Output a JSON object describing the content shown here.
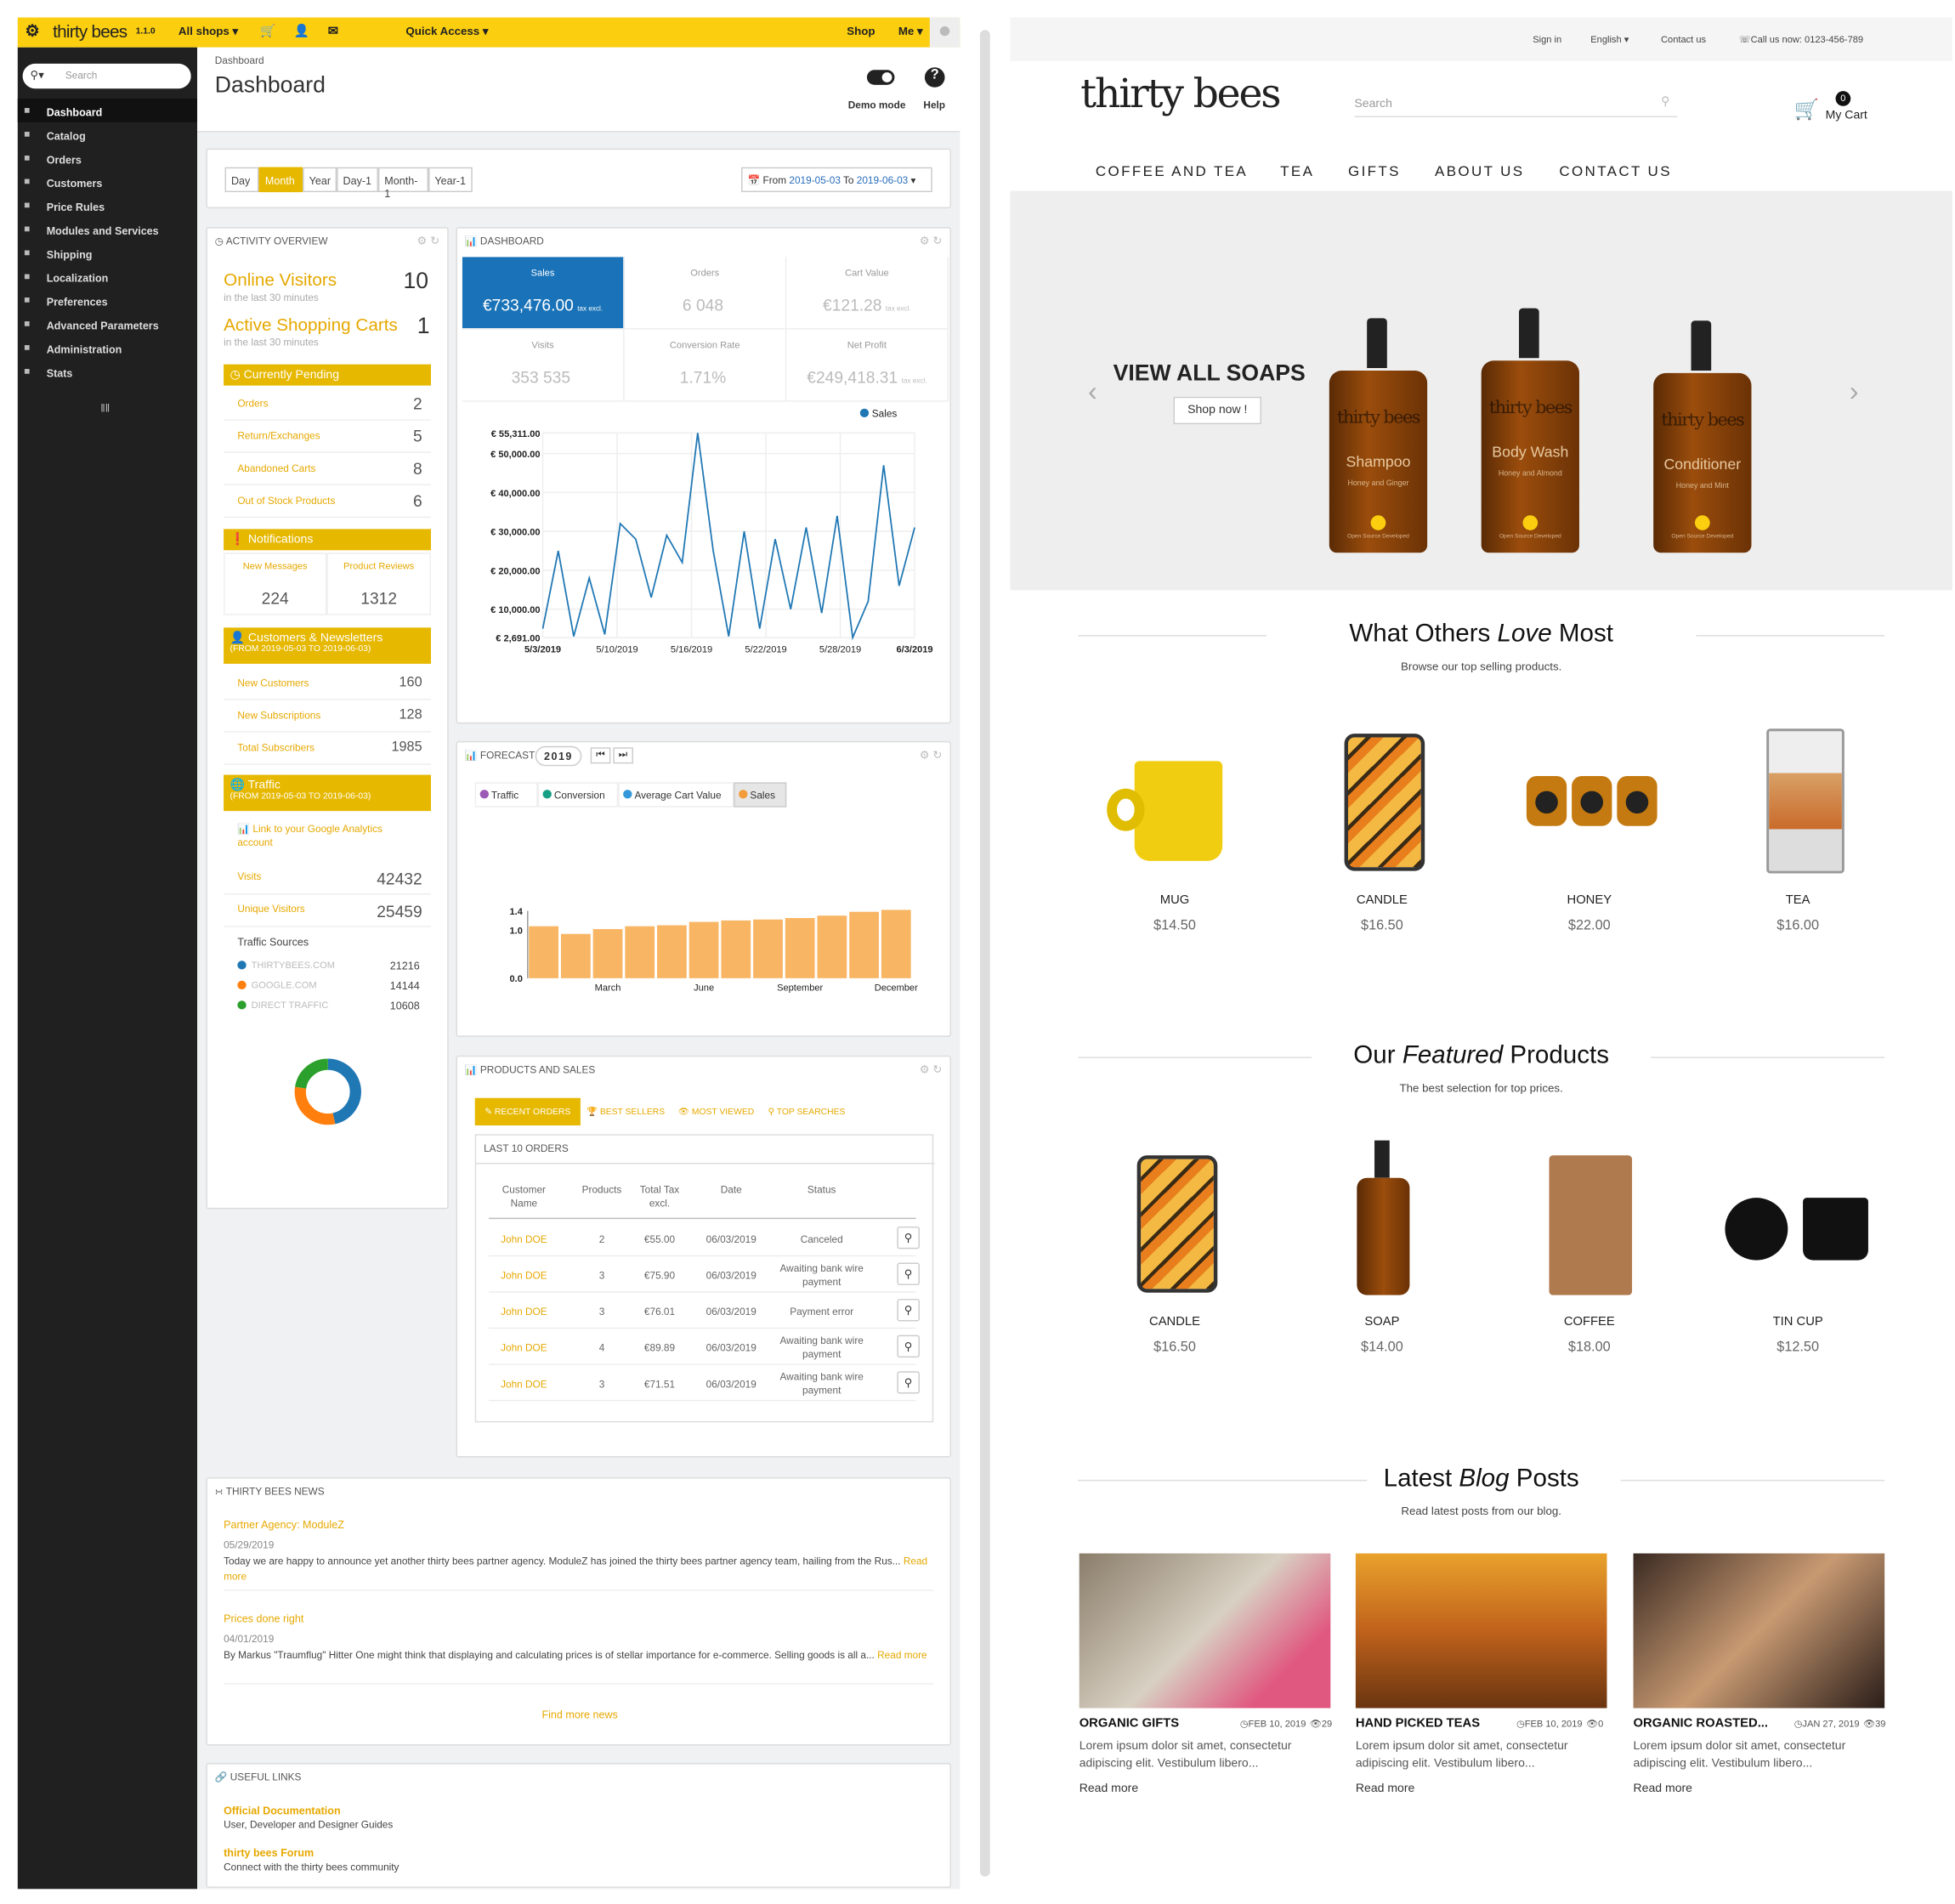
{
  "admin": {
    "logo": "thirty bees",
    "version": "1.1.0",
    "shops": "All shops",
    "quick_access": "Quick Access",
    "shop_link": "Shop",
    "me": "Me",
    "search_placeholder": "Search",
    "menu": [
      {
        "label": "Dashboard",
        "icon": "dashboard-icon"
      },
      {
        "label": "Catalog",
        "icon": "catalog-icon"
      },
      {
        "label": "Orders",
        "icon": "orders-icon"
      },
      {
        "label": "Customers",
        "icon": "customers-icon"
      },
      {
        "label": "Price Rules",
        "icon": "price-rules-icon"
      },
      {
        "label": "Modules and Services",
        "icon": "modules-icon"
      },
      {
        "label": "Shipping",
        "icon": "shipping-icon"
      },
      {
        "label": "Localization",
        "icon": "localization-icon"
      },
      {
        "label": "Preferences",
        "icon": "preferences-icon"
      },
      {
        "label": "Advanced Parameters",
        "icon": "advanced-icon"
      },
      {
        "label": "Administration",
        "icon": "administration-icon"
      },
      {
        "label": "Stats",
        "icon": "stats-icon"
      }
    ],
    "breadcrumb": "Dashboard",
    "page_title": "Dashboard",
    "demo_mode": "Demo mode",
    "help": "Help",
    "period_buttons": [
      "Day",
      "Month",
      "Year",
      "Day-1",
      "Month-1",
      "Year-1"
    ],
    "active_period": "Month",
    "date_from_label": "From",
    "date_from": "2019-05-03",
    "date_to_label": "To",
    "date_to": "2019-06-03",
    "activity": {
      "title": "Activity overview",
      "online_visitors": "Online Visitors",
      "online_visitors_value": "10",
      "sub1": "in the last 30 minutes",
      "active_carts": "Active Shopping Carts",
      "active_carts_value": "1",
      "sub2": "in the last 30 minutes",
      "pending_title": "Currently Pending",
      "pending": [
        {
          "label": "Orders",
          "value": "2"
        },
        {
          "label": "Return/Exchanges",
          "value": "5"
        },
        {
          "label": "Abandoned Carts",
          "value": "8"
        },
        {
          "label": "Out of Stock Products",
          "value": "6"
        }
      ],
      "notif_title": "Notifications",
      "new_messages": "New Messages",
      "new_messages_value": "224",
      "product_reviews": "Product Reviews",
      "product_reviews_value": "1312",
      "cust_title": "Customers & Newsletters",
      "cust_range": "(FROM 2019-05-03 TO 2019-06-03)",
      "cust": [
        {
          "label": "New Customers",
          "value": "160"
        },
        {
          "label": "New Subscriptions",
          "value": "128"
        },
        {
          "label": "Total Subscribers",
          "value": "1985"
        }
      ],
      "traffic_title": "Traffic",
      "traffic_range": "(FROM 2019-05-03 TO 2019-06-03)",
      "ga_link": "Link to your Google Analytics account",
      "visits": "Visits",
      "visits_value": "42432",
      "unique": "Unique Visitors",
      "unique_value": "25459",
      "sources_title": "Traffic Sources",
      "sources": [
        {
          "label": "THIRTYBEES.COM",
          "value": "21216",
          "color": "#1f77b4"
        },
        {
          "label": "GOOGLE.COM",
          "value": "14144",
          "color": "#ff7f0e"
        },
        {
          "label": "DIRECT TRAFFIC",
          "value": "10608",
          "color": "#2ca02c"
        }
      ]
    },
    "dashboard": {
      "title": "Dashboard",
      "kpis": [
        {
          "label": "Sales",
          "value": "€733,476.00",
          "unit": "tax excl."
        },
        {
          "label": "Orders",
          "value": "6 048",
          "unit": ""
        },
        {
          "label": "Cart Value",
          "value": "€121.28",
          "unit": "tax excl."
        },
        {
          "label": "Visits",
          "value": "353 535",
          "unit": ""
        },
        {
          "label": "Conversion Rate",
          "value": "1.71%",
          "unit": ""
        },
        {
          "label": "Net Profit",
          "value": "€249,418.31",
          "unit": "tax excl."
        }
      ]
    },
    "forecast": {
      "title": "Forecast",
      "year": "2019",
      "legend": [
        "Traffic",
        "Conversion",
        "Average Cart Value",
        "Sales"
      ],
      "legend_colors": [
        "#9c59b6",
        "#16a085",
        "#3498db",
        "#f39c3b"
      ]
    },
    "products": {
      "title": "Products and Sales",
      "tabs": [
        "RECENT ORDERS",
        "BEST SELLERS",
        "MOST VIEWED",
        "TOP SEARCHES"
      ],
      "table_title": "LAST 10 ORDERS",
      "headers": [
        "Customer Name",
        "Products",
        "Total Tax excl.",
        "Date",
        "Status"
      ],
      "rows": [
        {
          "name": "John DOE",
          "products": "2",
          "total": "€55.00",
          "date": "06/03/2019",
          "status": "Canceled"
        },
        {
          "name": "John DOE",
          "products": "3",
          "total": "€75.90",
          "date": "06/03/2019",
          "status": "Awaiting bank wire payment"
        },
        {
          "name": "John DOE",
          "products": "3",
          "total": "€76.01",
          "date": "06/03/2019",
          "status": "Payment error"
        },
        {
          "name": "John DOE",
          "products": "4",
          "total": "€89.89",
          "date": "06/03/2019",
          "status": "Awaiting bank wire payment"
        },
        {
          "name": "John DOE",
          "products": "3",
          "total": "€71.51",
          "date": "06/03/2019",
          "status": "Awaiting bank wire payment"
        }
      ]
    },
    "news": {
      "title": "Thirty bees news",
      "items": [
        {
          "title": "Partner Agency: ModuleZ",
          "date": "05/29/2019",
          "text": "Today we are happy to announce yet another thirty bees partner agency. ModuleZ has joined the thirty bees partner agency team, hailing from the Rus...",
          "more": "Read more"
        },
        {
          "title": "Prices done right",
          "date": "04/01/2019",
          "text": "By Markus \"Traumflug\" Hitter One might think that displaying and calculating prices is of stellar importance for e-commerce. Selling goods is all a...",
          "more": "Read more"
        }
      ],
      "find_more": "Find more news"
    },
    "links": {
      "title": "Useful links",
      "items": [
        {
          "title": "Official Documentation",
          "sub": "User, Developer and Designer Guides"
        },
        {
          "title": "thirty bees Forum",
          "sub": "Connect with the thirty bees community"
        }
      ]
    }
  },
  "chart_data": [
    {
      "type": "line",
      "title": "",
      "series": [
        {
          "name": "Sales",
          "values": [
            5000,
            25000,
            3000,
            18000,
            3500,
            32000,
            28000,
            13000,
            29000,
            22000,
            55311,
            25000,
            3000,
            30000,
            5000,
            28000,
            10000,
            31000,
            9000,
            34000,
            2691,
            12000,
            47000,
            16000,
            31000
          ]
        }
      ],
      "x_ticks": [
        "5/3/2019",
        "5/10/2019",
        "5/16/2019",
        "5/22/2019",
        "5/28/2019",
        "6/3/2019"
      ],
      "y_ticks": [
        "€ 55,311.00",
        "€ 50,000.00",
        "€ 40,000.00",
        "€ 30,000.00",
        "€ 20,000.00",
        "€ 10,000.00",
        "€ 2,691.00"
      ],
      "ylim": [
        2691,
        55311
      ],
      "legend": "top-right"
    },
    {
      "type": "bar",
      "title": "",
      "series": [
        {
          "name": "Sales",
          "values": [
            1.08,
            0.92,
            1.02,
            1.08,
            1.1,
            1.17,
            1.2,
            1.22,
            1.25,
            1.3,
            1.38,
            1.42
          ]
        }
      ],
      "x_ticks": [
        "March",
        "June",
        "September",
        "December"
      ],
      "y_ticks": [
        "1.4",
        "1.0",
        "0.0"
      ],
      "ylim": [
        0,
        1.4
      ]
    }
  ],
  "shop": {
    "top_links": [
      "Sign in",
      "English",
      "Contact us",
      "Call us now: 0123-456-789"
    ],
    "logo": "thirty bees",
    "search_placeholder": "Search",
    "cart_count": "0",
    "cart_label": "My Cart",
    "categories": [
      "COFFEE AND TEA",
      "TEA",
      "GIFTS",
      "ABOUT US",
      "CONTACT US"
    ],
    "hero": {
      "title": "VIEW ALL SOAPS",
      "button": "Shop now !",
      "bottles": [
        {
          "brand": "thirty bees",
          "name": "Shampoo",
          "sub": "Honey and Ginger"
        },
        {
          "brand": "thirty bees",
          "name": "Body Wash",
          "sub": "Honey and Almond"
        },
        {
          "brand": "thirty bees",
          "name": "Conditioner",
          "sub": "Honey and Mint"
        }
      ],
      "bottle_tag": "Open Source Developed"
    },
    "section1": {
      "title_a": "What Others ",
      "title_b": "Love",
      "title_c": " Most",
      "sub": "Browse our top selling products.",
      "products": [
        {
          "name": "MUG",
          "price": "$14.50"
        },
        {
          "name": "CANDLE",
          "price": "$16.50"
        },
        {
          "name": "HONEY",
          "price": "$22.00"
        },
        {
          "name": "TEA",
          "price": "$16.00"
        }
      ]
    },
    "section2": {
      "title_a": "Our ",
      "title_b": "Featured",
      "title_c": " Products",
      "sub": "The best selection for top prices.",
      "products": [
        {
          "name": "CANDLE",
          "price": "$16.50"
        },
        {
          "name": "SOAP",
          "price": "$14.00"
        },
        {
          "name": "COFFEE",
          "price": "$18.00"
        },
        {
          "name": "TIN CUP",
          "price": "$12.50"
        }
      ]
    },
    "section3": {
      "title_a": "Latest ",
      "title_b": "Blog",
      "title_c": " Posts",
      "sub": "Read latest posts from our blog.",
      "posts": [
        {
          "title": "ORGANIC GIFTS",
          "date": "FEB 10, 2019",
          "views": "29",
          "text": "Lorem ipsum dolor sit amet, consectetur adipiscing elit. Vestibulum libero...",
          "more": "Read more"
        },
        {
          "title": "HAND PICKED TEAS",
          "date": "FEB 10, 2019",
          "views": "0",
          "text": "Lorem ipsum dolor sit amet, consectetur adipiscing elit. Vestibulum libero...",
          "more": "Read more"
        },
        {
          "title": "ORGANIC ROASTED...",
          "date": "JAN 27, 2019",
          "views": "39",
          "text": "Lorem ipsum dolor sit amet, consectetur adipiscing elit. Vestibulum libero...",
          "more": "Read more"
        }
      ]
    }
  }
}
